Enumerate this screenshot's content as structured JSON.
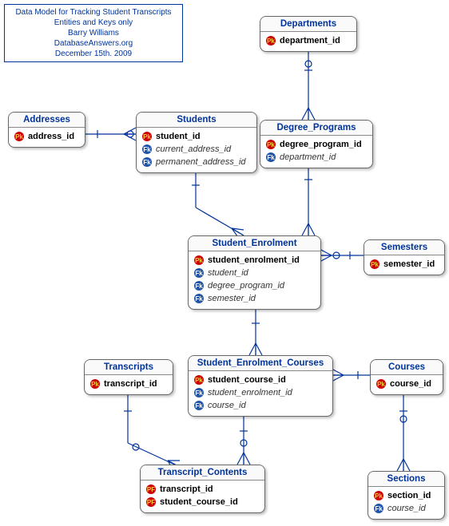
{
  "title": {
    "line1": "Data Model for Tracking Student Transcripts",
    "line2": "Entities and Keys only",
    "line3": "Barry Williams",
    "line4": "DatabaseAnswers.org",
    "line5": "December 15th. 2009"
  },
  "entities": {
    "departments": {
      "name": "Departments",
      "attrs": [
        {
          "kind": "pk",
          "name": "department_id"
        }
      ]
    },
    "addresses": {
      "name": "Addresses",
      "attrs": [
        {
          "kind": "pk",
          "name": "address_id"
        }
      ]
    },
    "students": {
      "name": "Students",
      "attrs": [
        {
          "kind": "pk",
          "name": "student_id"
        },
        {
          "kind": "fk",
          "name": "current_address_id"
        },
        {
          "kind": "fk",
          "name": "permanent_address_id"
        }
      ]
    },
    "degree_programs": {
      "name": "Degree_Programs",
      "attrs": [
        {
          "kind": "pk",
          "name": "degree_program_id"
        },
        {
          "kind": "fk",
          "name": "department_id"
        }
      ]
    },
    "student_enrolment": {
      "name": "Student_Enrolment",
      "attrs": [
        {
          "kind": "pk",
          "name": "student_enrolment_id"
        },
        {
          "kind": "fk",
          "name": "student_id"
        },
        {
          "kind": "fk",
          "name": "degree_program_id"
        },
        {
          "kind": "fk",
          "name": "semester_id"
        }
      ]
    },
    "semesters": {
      "name": "Semesters",
      "attrs": [
        {
          "kind": "pk",
          "name": "semester_id"
        }
      ]
    },
    "transcripts": {
      "name": "Transcripts",
      "attrs": [
        {
          "kind": "pk",
          "name": "transcript_id"
        }
      ]
    },
    "student_enrolment_courses": {
      "name": "Student_Enrolment_Courses",
      "attrs": [
        {
          "kind": "pk",
          "name": "student_course_id"
        },
        {
          "kind": "fk",
          "name": "student_enrolment_id"
        },
        {
          "kind": "fk",
          "name": "course_id"
        }
      ]
    },
    "courses": {
      "name": "Courses",
      "attrs": [
        {
          "kind": "pk",
          "name": "course_id"
        }
      ]
    },
    "transcript_contents": {
      "name": "Transcript_Contents",
      "attrs": [
        {
          "kind": "pf",
          "name": "transcript_id"
        },
        {
          "kind": "pf",
          "name": "student_course_id"
        }
      ]
    },
    "sections": {
      "name": "Sections",
      "attrs": [
        {
          "kind": "pk",
          "name": "section_id"
        },
        {
          "kind": "fk",
          "name": "course_id"
        }
      ]
    }
  }
}
